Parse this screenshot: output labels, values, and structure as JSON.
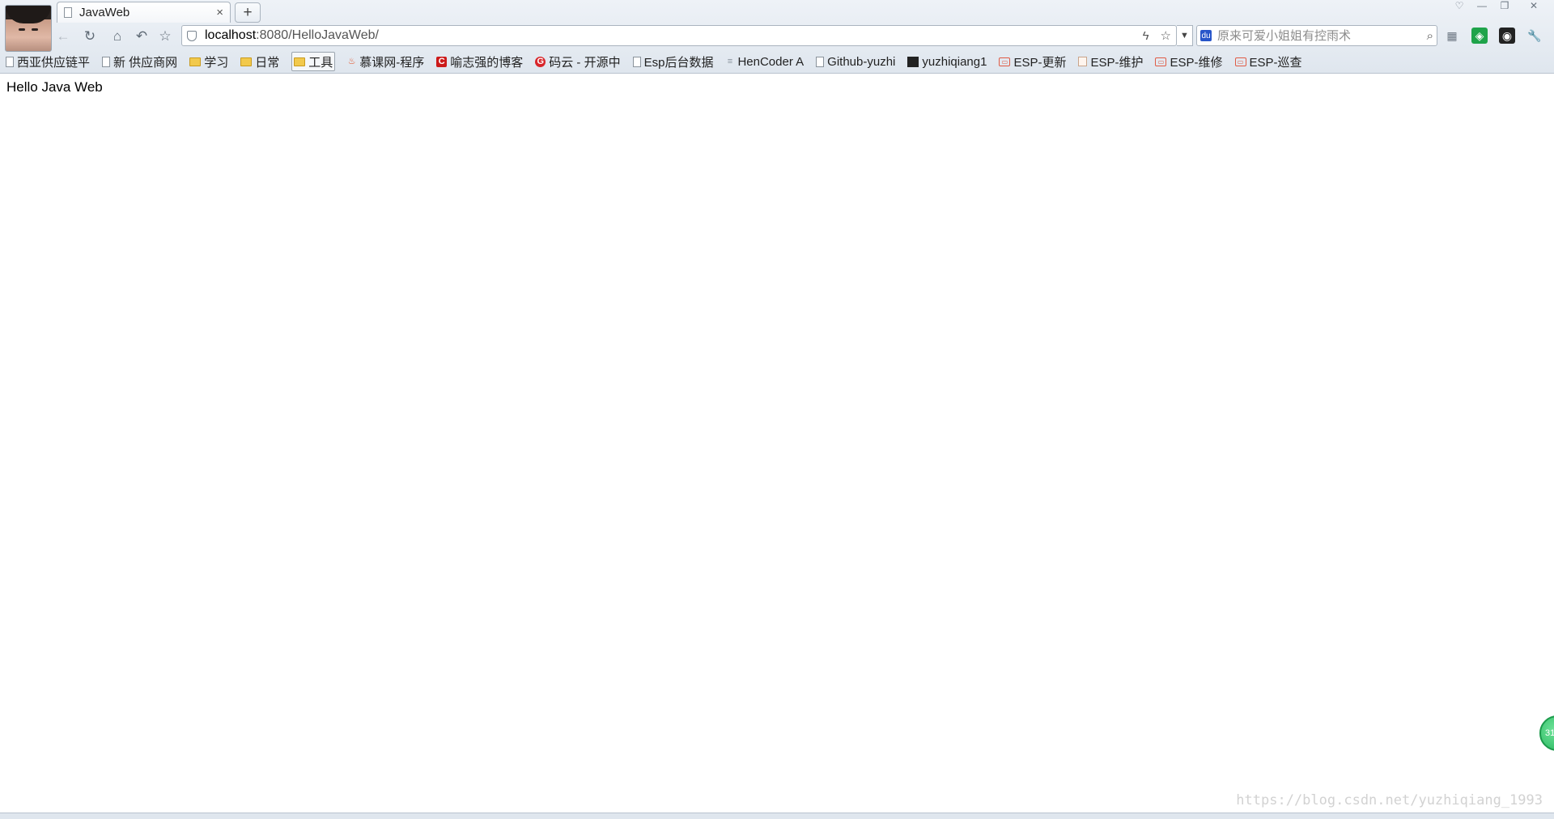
{
  "tab": {
    "title": "JavaWeb",
    "close": "×",
    "new_tab": "+"
  },
  "window_controls": {
    "skin": "♡",
    "minimize": "—",
    "restore": "❐",
    "close": "✕"
  },
  "nav": {
    "back": "←",
    "reload": "↻",
    "home": "⌂",
    "undo": "↶",
    "favorite": "☆"
  },
  "address": {
    "host": "localhost",
    "rest": ":8080/HelloJavaWeb/",
    "fast_icon": "ϟ",
    "star_icon": "☆",
    "dropdown": "▼"
  },
  "search": {
    "placeholder": "原来可爱小姐姐有控雨术",
    "engine": "du",
    "icon": "⌕"
  },
  "extensions": [
    "▦",
    "◈",
    "◉",
    "🔧"
  ],
  "bookmarks": [
    {
      "label": "西亚供应链平",
      "icon": "page"
    },
    {
      "label": "新 供应商网",
      "icon": "page"
    },
    {
      "label": "学习",
      "icon": "folder"
    },
    {
      "label": "日常",
      "icon": "folder"
    },
    {
      "label": "工具",
      "icon": "folder",
      "active": true
    },
    {
      "label": "慕课网-程序",
      "icon": "flame"
    },
    {
      "label": "喻志强的博客",
      "icon": "red"
    },
    {
      "label": "码云 - 开源中",
      "icon": "redcircle"
    },
    {
      "label": "Esp后台数据",
      "icon": "page"
    },
    {
      "label": "HenCoder A",
      "icon": "lines"
    },
    {
      "label": "Github-yuzhi",
      "icon": "page"
    },
    {
      "label": "yuzhiqiang1",
      "icon": "dark"
    },
    {
      "label": "ESP-更新",
      "icon": "esp"
    },
    {
      "label": "ESP-维护",
      "icon": "esp2"
    },
    {
      "label": "ESP-维修",
      "icon": "esp"
    },
    {
      "label": "ESP-巡查",
      "icon": "esp"
    }
  ],
  "content": {
    "text": "Hello Java Web"
  },
  "badge": {
    "text": "31"
  },
  "watermark": "https://blog.csdn.net/yuzhiqiang_1993"
}
